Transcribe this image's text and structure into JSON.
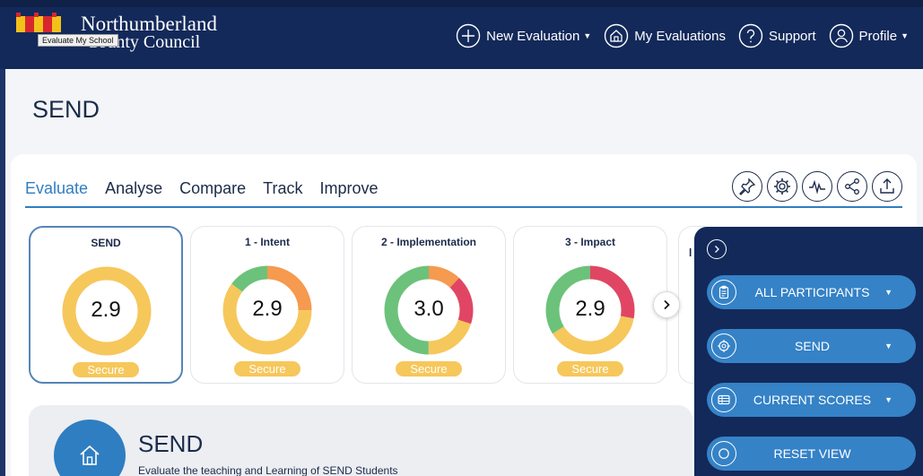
{
  "header": {
    "logo_line1": "Northumberland",
    "logo_line2": "County Council",
    "logo_tooltip": "Evaluate My School",
    "nav": [
      {
        "label": "New Evaluation",
        "icon": "plus-circle-icon",
        "has_caret": true
      },
      {
        "label": "My Evaluations",
        "icon": "home-circle-icon",
        "has_caret": false
      },
      {
        "label": "Support",
        "icon": "question-circle-icon",
        "has_caret": false
      },
      {
        "label": "Profile",
        "icon": "user-circle-icon",
        "has_caret": true
      }
    ]
  },
  "page": {
    "title": "SEND"
  },
  "tabs": [
    {
      "label": "Evaluate",
      "active": true
    },
    {
      "label": "Analyse",
      "active": false
    },
    {
      "label": "Compare",
      "active": false
    },
    {
      "label": "Track",
      "active": false
    },
    {
      "label": "Improve",
      "active": false
    }
  ],
  "tool_icons": [
    "pin-icon",
    "settings-gear-icon",
    "pulse-icon",
    "share-icon",
    "upload-icon"
  ],
  "scores": [
    {
      "title": "SEND",
      "value": "2.9",
      "badge": "Secure",
      "selected": true,
      "segments": [
        {
          "color": "#f6c75b",
          "fraction": 1.0
        }
      ]
    },
    {
      "title": "1 - Intent",
      "value": "2.9",
      "badge": "Secure",
      "selected": false,
      "segments": [
        {
          "color": "#f59a4f",
          "fraction": 0.25
        },
        {
          "color": "#f6c75b",
          "fraction": 0.6
        },
        {
          "color": "#6cc27a",
          "fraction": 0.15
        }
      ]
    },
    {
      "title": "2 - Implementation",
      "value": "3.0",
      "badge": "Secure",
      "selected": false,
      "segments": [
        {
          "color": "#f59a4f",
          "fraction": 0.12
        },
        {
          "color": "#e04663",
          "fraction": 0.18
        },
        {
          "color": "#f6c75b",
          "fraction": 0.2
        },
        {
          "color": "#6cc27a",
          "fraction": 0.5
        }
      ]
    },
    {
      "title": "3 - Impact",
      "value": "2.9",
      "badge": "Secure",
      "selected": false,
      "segments": [
        {
          "color": "#e04663",
          "fraction": 0.28
        },
        {
          "color": "#f6c75b",
          "fraction": 0.38
        },
        {
          "color": "#6cc27a",
          "fraction": 0.34
        }
      ]
    }
  ],
  "partial_card_title": "l",
  "section": {
    "title": "SEND",
    "subtitle": "Evaluate the teaching and Learning of SEND Students"
  },
  "side_panel": {
    "buttons": [
      {
        "label": "ALL PARTICIPANTS",
        "icon": "clipboard-icon",
        "has_caret": true
      },
      {
        "label": "SEND",
        "icon": "target-icon",
        "has_caret": true
      },
      {
        "label": "CURRENT SCORES",
        "icon": "table-icon",
        "has_caret": true
      },
      {
        "label": "RESET VIEW",
        "icon": "refresh-icon",
        "has_caret": false
      }
    ]
  },
  "colors": {
    "header_bg": "#13295a",
    "accent": "#2f7ec1",
    "secure_badge": "#f6c75b"
  }
}
